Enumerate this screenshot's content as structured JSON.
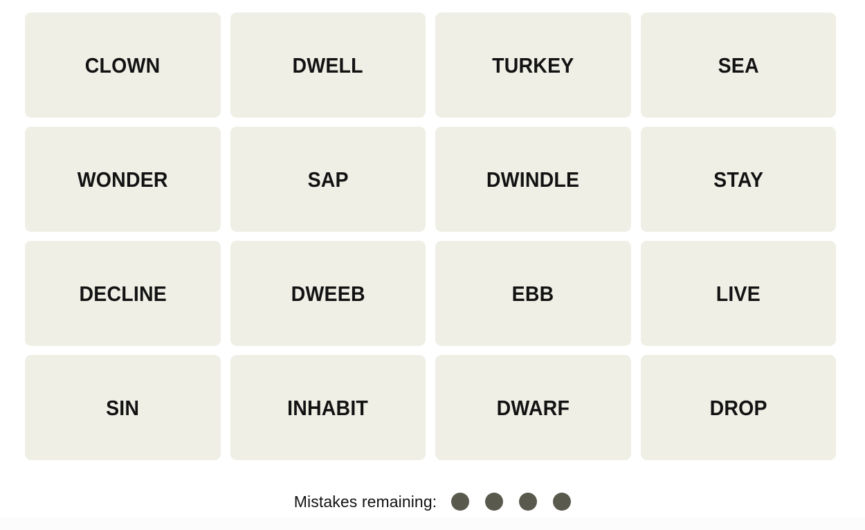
{
  "game": {
    "name": "Connections",
    "board": {
      "columns": 4,
      "rows": 4,
      "tile_background": "#EFEFE6",
      "tile_text_color": "#121212",
      "tiles": [
        {
          "word": "CLOWN",
          "row": 1,
          "col": 1,
          "selected": false
        },
        {
          "word": "DWELL",
          "row": 1,
          "col": 2,
          "selected": false
        },
        {
          "word": "TURKEY",
          "row": 1,
          "col": 3,
          "selected": false
        },
        {
          "word": "SEA",
          "row": 1,
          "col": 4,
          "selected": false
        },
        {
          "word": "WONDER",
          "row": 2,
          "col": 1,
          "selected": false
        },
        {
          "word": "SAP",
          "row": 2,
          "col": 2,
          "selected": false
        },
        {
          "word": "DWINDLE",
          "row": 2,
          "col": 3,
          "selected": false
        },
        {
          "word": "STAY",
          "row": 2,
          "col": 4,
          "selected": false
        },
        {
          "word": "DECLINE",
          "row": 3,
          "col": 1,
          "selected": false
        },
        {
          "word": "DWEEB",
          "row": 3,
          "col": 2,
          "selected": false
        },
        {
          "word": "EBB",
          "row": 3,
          "col": 3,
          "selected": false
        },
        {
          "word": "LIVE",
          "row": 3,
          "col": 4,
          "selected": false
        },
        {
          "word": "SIN",
          "row": 4,
          "col": 1,
          "selected": false
        },
        {
          "word": "INHABIT",
          "row": 4,
          "col": 2,
          "selected": false
        },
        {
          "word": "DWARF",
          "row": 4,
          "col": 3,
          "selected": false
        },
        {
          "word": "DROP",
          "row": 4,
          "col": 4,
          "selected": false
        }
      ]
    },
    "mistakes": {
      "label": "Mistakes remaining:",
      "remaining": 4,
      "total": 4,
      "dot_color": "#5A594E",
      "dots": [
        {
          "index": 1,
          "used": false
        },
        {
          "index": 2,
          "used": false
        },
        {
          "index": 3,
          "used": false
        },
        {
          "index": 4,
          "used": false
        }
      ]
    },
    "colors": {
      "page_background": "#FFFFFF",
      "tile": "#EFEFE6",
      "text": "#121212",
      "dot": "#5A594E"
    }
  }
}
